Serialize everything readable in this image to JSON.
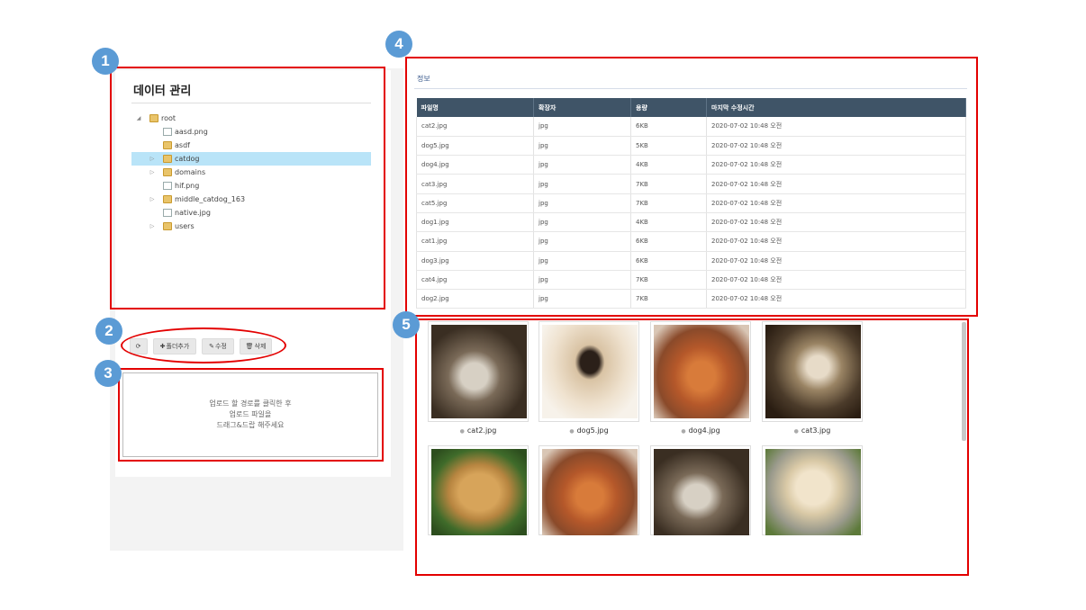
{
  "tree_panel": {
    "title": "데이터 관리",
    "items": [
      {
        "label": "root",
        "type": "folder",
        "expander": "◢",
        "level": 0
      },
      {
        "label": "aasd.png",
        "type": "file",
        "expander": "",
        "level": 1
      },
      {
        "label": "asdf",
        "type": "folder",
        "expander": "",
        "level": 1
      },
      {
        "label": "catdog",
        "type": "folder",
        "expander": "▷",
        "level": 1,
        "selected": true
      },
      {
        "label": "domains",
        "type": "folder",
        "expander": "▷",
        "level": 1
      },
      {
        "label": "hif.png",
        "type": "file",
        "expander": "",
        "level": 1
      },
      {
        "label": "middle_catdog_163",
        "type": "folder",
        "expander": "▷",
        "level": 1
      },
      {
        "label": "native.jpg",
        "type": "file",
        "expander": "",
        "level": 1
      },
      {
        "label": "users",
        "type": "folder",
        "expander": "▷",
        "level": 1
      }
    ]
  },
  "toolbar": {
    "refresh_icon": "⟳",
    "add_folder_icon": "✚",
    "add_folder_label": "폴더추가",
    "edit_icon": "✎",
    "edit_label": "수정",
    "delete_icon": "🗑",
    "delete_label": "삭제"
  },
  "dropzone": {
    "line1": "업로드 할 경로를 클릭한 후",
    "line2": "업로드 파일을",
    "line3": "드래그&드랍 해주세요"
  },
  "info_panel": {
    "title": "정보",
    "columns": [
      "파일명",
      "확장자",
      "용량",
      "마지막 수정시간"
    ],
    "rows": [
      [
        "cat2.jpg",
        "jpg",
        "6KB",
        "2020-07-02 10:48 오전"
      ],
      [
        "dog5.jpg",
        "jpg",
        "5KB",
        "2020-07-02 10:48 오전"
      ],
      [
        "dog4.jpg",
        "jpg",
        "4KB",
        "2020-07-02 10:48 오전"
      ],
      [
        "cat3.jpg",
        "jpg",
        "7KB",
        "2020-07-02 10:48 오전"
      ],
      [
        "cat5.jpg",
        "jpg",
        "7KB",
        "2020-07-02 10:48 오전"
      ],
      [
        "dog1.jpg",
        "jpg",
        "4KB",
        "2020-07-02 10:48 오전"
      ],
      [
        "cat1.jpg",
        "jpg",
        "6KB",
        "2020-07-02 10:48 오전"
      ],
      [
        "dog3.jpg",
        "jpg",
        "6KB",
        "2020-07-02 10:48 오전"
      ],
      [
        "cat4.jpg",
        "jpg",
        "7KB",
        "2020-07-02 10:48 오전"
      ],
      [
        "dog2.jpg",
        "jpg",
        "7KB",
        "2020-07-02 10:48 오전"
      ]
    ]
  },
  "gallery": {
    "items": [
      {
        "caption": "cat2.jpg",
        "image": "cat-photo"
      },
      {
        "caption": "dog5.jpg",
        "image": "pug-photo"
      },
      {
        "caption": "dog4.jpg",
        "image": "dog-photo"
      },
      {
        "caption": "cat3.jpg",
        "image": "cat-photo"
      },
      {
        "caption": "",
        "image": "dog-photo"
      },
      {
        "caption": "",
        "image": "dog-photo"
      },
      {
        "caption": "",
        "image": "cat-photo"
      },
      {
        "caption": "",
        "image": "puppies-photo"
      }
    ]
  },
  "annotations": {
    "badges": [
      "1",
      "2",
      "3",
      "4",
      "5"
    ],
    "color": "#e30000",
    "badge_color": "#5b9bd5"
  }
}
